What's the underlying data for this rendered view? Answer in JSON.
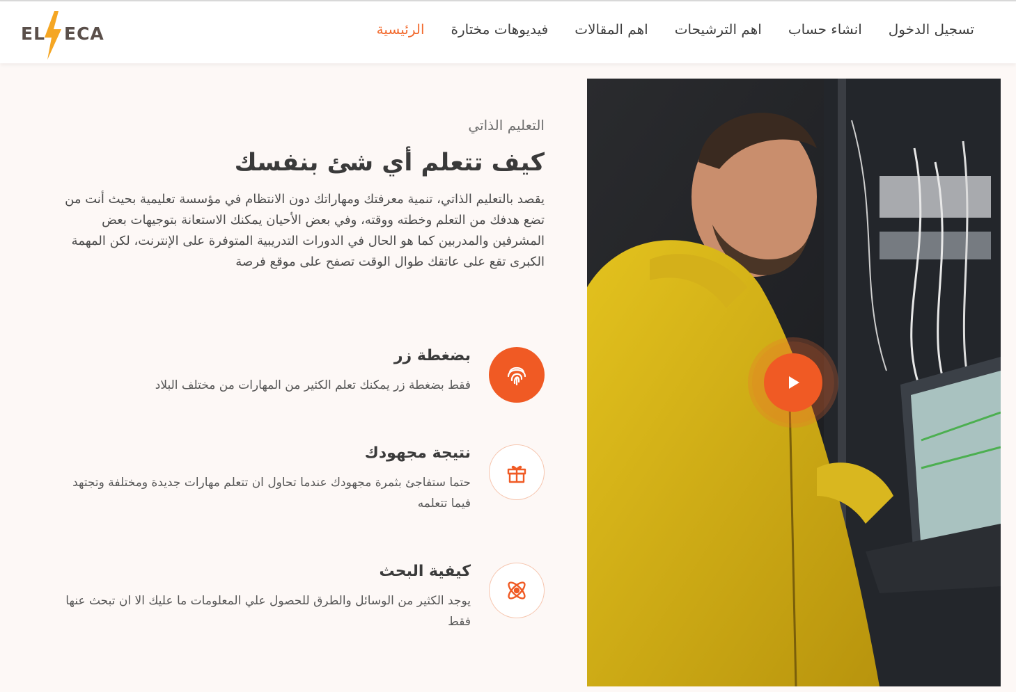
{
  "brand": {
    "logo_left": "EL",
    "logo_right": "ECA",
    "logo_icon": "lightning-bolt-icon",
    "accent_color": "#f05a24",
    "nav_active_color": "#f26a2e"
  },
  "nav": {
    "items": [
      {
        "label": "الرئيسية",
        "active": true
      },
      {
        "label": "فيديوهات مختارة",
        "active": false
      },
      {
        "label": "اهم المقالات",
        "active": false
      },
      {
        "label": "اهم الترشيحات",
        "active": false
      },
      {
        "label": "انشاء حساب",
        "active": false
      },
      {
        "label": "تسجيل الدخول",
        "active": false
      }
    ]
  },
  "hero": {
    "image_icon": "technician-server-room-image",
    "play_icon": "play-icon"
  },
  "intro": {
    "eyebrow": "التعليم الذاتي",
    "title": "كيف تتعلم أي شئ بنفسك",
    "description": "يقصد بالتعليم الذاتي، تنمية معرفتك ومهاراتك دون الانتظام في مؤسسة تعليمية بحيث أنت من تضع هدفك من التعلم وخطته ووقته، وفي بعض الأحيان يمكنك الاستعانة بتوجيهات بعض المشرفين والمدربين كما هو الحال في الدورات التدريبية المتوفرة على الإنترنت، لكن المهمة الكبرى تقع على عاتقك طوال الوقت تصفح على موقع فرصة"
  },
  "features": [
    {
      "icon": "fingerprint-icon",
      "title": "بضغطة زر",
      "text": "فقط بضغطة زر يمكنك تعلم الكثير من المهارات من مختلف البلاد"
    },
    {
      "icon": "gift-icon",
      "title": "نتيجة مجهودك",
      "text": "حتما ستفاجئ بثمرة مجهودك عندما تحاول ان تتعلم مهارات جديدة ومختلفة وتجتهد فيما تتعلمه"
    },
    {
      "icon": "atom-icon",
      "title": "كيفية البحث",
      "text": "يوجد الكثير من الوسائل والطرق للحصول علي المعلومات ما عليك الا ان تبحث عنها فقط"
    }
  ]
}
